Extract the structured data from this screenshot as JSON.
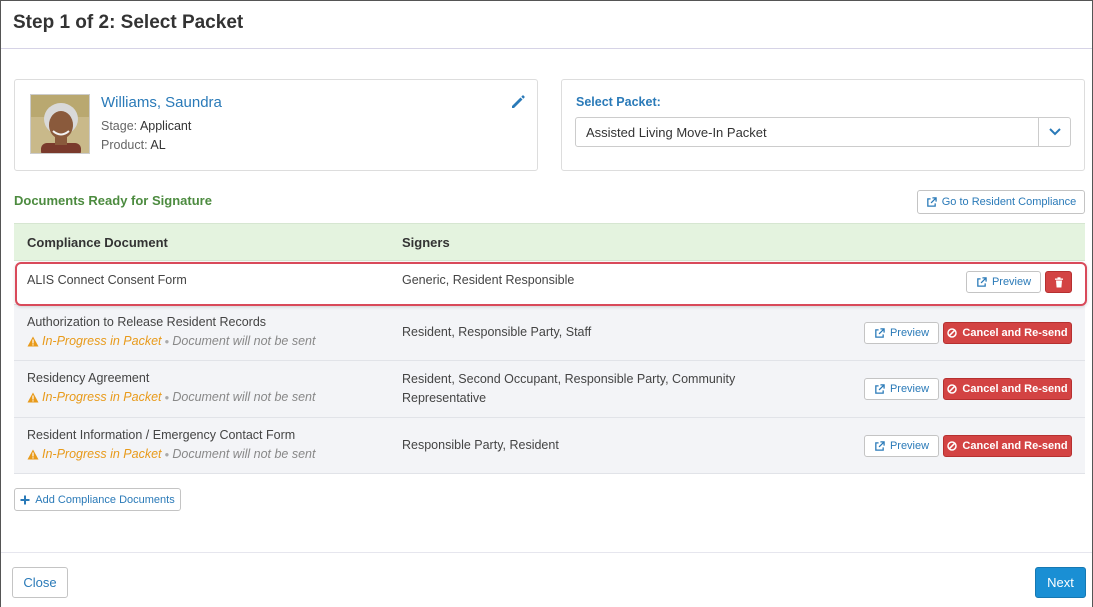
{
  "header": {
    "title": "Step 1 of 2: Select Packet"
  },
  "resident": {
    "name": "Williams, Saundra",
    "stage_label": "Stage:",
    "stage_value": "Applicant",
    "product_label": "Product:",
    "product_value": "AL"
  },
  "packet": {
    "label": "Select Packet:",
    "selected": "Assisted Living Move-In Packet"
  },
  "documents": {
    "section_title": "Documents Ready for Signature",
    "go_compliance_label": "Go to Resident Compliance",
    "columns": [
      "Compliance Document",
      "Signers"
    ],
    "rows": [
      {
        "document": "ALIS Connect Consent Form",
        "signers": "Generic, Resident Responsible",
        "status_inprogress": "",
        "status_note": "",
        "preview_label": "Preview",
        "action": "delete"
      },
      {
        "document": "Authorization to Release Resident Records",
        "signers": "Resident, Responsible Party, Staff",
        "status_inprogress": "In-Progress in Packet",
        "status_note": "Document will not be sent",
        "preview_label": "Preview",
        "action_label": "Cancel and Re-send"
      },
      {
        "document": "Residency Agreement",
        "signers": "Resident, Second Occupant, Responsible Party, Community Representative",
        "signers_line1": "Resident, Second Occupant, Responsible Party, Community",
        "signers_line2": "Representative",
        "status_inprogress": "In-Progress in Packet",
        "status_note": "Document will not be sent",
        "preview_label": "Preview",
        "action_label": "Cancel and Re-send"
      },
      {
        "document": "Resident Information / Emergency Contact Form",
        "signers": "Responsible Party, Resident",
        "status_inprogress": "In-Progress in Packet",
        "status_note": "Document will not be sent",
        "preview_label": "Preview",
        "action_label": "Cancel and Re-send"
      }
    ],
    "add_label": "Add Compliance Documents"
  },
  "footer": {
    "close_label": "Close",
    "next_label": "Next"
  },
  "colors": {
    "accent": "#2a7ab8",
    "success": "#4c8b3f",
    "danger": "#d34343",
    "warning": "#e89a1a",
    "primary": "#1a8fd4",
    "highlight": "#d94a5a"
  }
}
